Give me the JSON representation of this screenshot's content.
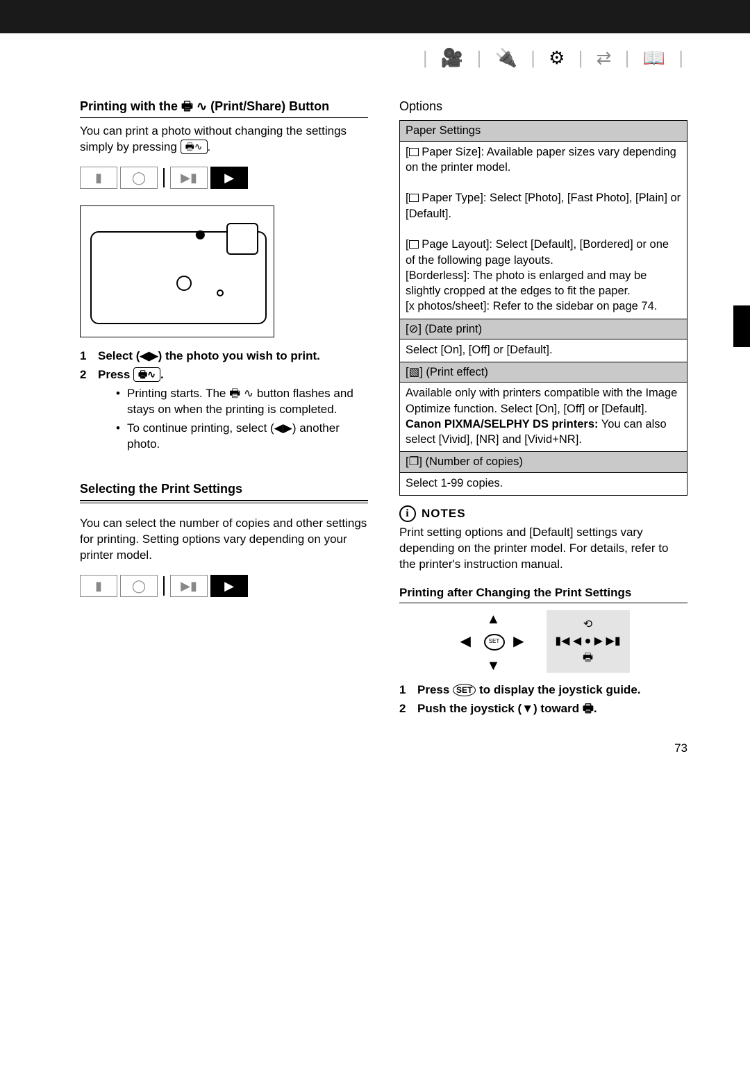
{
  "header_icons": [
    "camcorder",
    "plug",
    "gear-active",
    "transfer",
    "book"
  ],
  "left": {
    "section1_title_a": "Printing with the ",
    "section1_title_b": " (Print/Share) Button",
    "section1_body_a": "You can print a photo without changing the settings simply by pressing ",
    "section1_body_b": ".",
    "step1": "Select (◀▶) the photo you wish to print.",
    "step2_a": "Press ",
    "step2_b": ".",
    "step2_bul1_a": "Printing starts. The ",
    "step2_bul1_b": " button flashes and stays on when the printing is completed.",
    "step2_bul2": "To continue printing, select (◀▶) another photo.",
    "section2_title": "Selecting the Print Settings",
    "section2_body": "You can select the number of copies and other settings for printing. Setting options vary depending on your printer model."
  },
  "right": {
    "options_label": "Options",
    "table": {
      "paper_settings_hdr": "Paper Settings",
      "paper_size": "Paper Size]: Available paper sizes vary depending on the printer model.",
      "paper_type": "Paper Type]: Select [Photo], [Fast Photo], [Plain] or [Default].",
      "page_layout": "Page Layout]: Select [Default], [Bordered] or one of the following page layouts.",
      "borderless": "[Borderless]: The photo is enlarged and may be slightly cropped at the edges to fit the paper.",
      "xphotos": "[x photos/sheet]: Refer to the sidebar on page 74.",
      "date_print_hdr": "] (Date print)",
      "date_print_body": "Select [On], [Off] or [Default].",
      "print_effect_hdr": "] (Print effect)",
      "print_effect_body": "Available only with printers compatible with the Image Optimize function. Select [On], [Off] or [Default].",
      "print_effect_bold": "Canon PIXMA/SELPHY DS printers:",
      "print_effect_after": " You can also select [Vivid], [NR] and [Vivid+NR].",
      "copies_hdr": "] (Number of copies)",
      "copies_body": "Select 1-99 copies."
    },
    "notes_label": "NOTES",
    "notes_body": "Print setting options and [Default] settings vary depending on the printer model. For details, refer to the printer's instruction manual.",
    "sub_title": "Printing after Changing the Print Settings",
    "step1_a": "Press ",
    "step1_b": " to display the joystick guide.",
    "step2": "Push the joystick (▼) toward 🖶."
  },
  "page_number": "73"
}
